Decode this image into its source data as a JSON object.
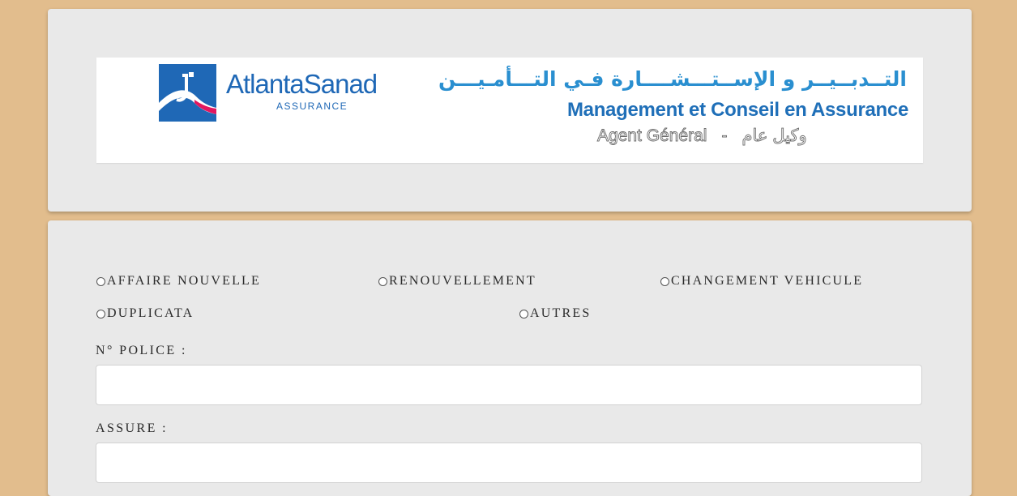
{
  "header": {
    "logo": {
      "name": "AtlantaSanad",
      "subtitle": "ASSURANCE",
      "icon": "atlantasanad-logo-icon"
    },
    "arabic_title": "التــدبــيــر و الإســتـــشــــارة فـي التـــأمـيـــن",
    "french_title": "Management et Conseil en Assurance",
    "agent_fr": "Agent Général",
    "separator": "-",
    "agent_ar": "وكيل عام"
  },
  "form": {
    "options": [
      {
        "label": "AFFAIRE NOUVELLE",
        "selected": false
      },
      {
        "label": "RENOUVELLEMENT",
        "selected": false
      },
      {
        "label": "CHANGEMENT VEHICULE",
        "selected": false
      },
      {
        "label": "DUPLICATA",
        "selected": false
      },
      {
        "label": "AUTRES",
        "selected": false
      }
    ],
    "police_label": "N° POLICE :",
    "police_value": "",
    "assure_label": "ASSURE :",
    "assure_value": ""
  },
  "colors": {
    "page_background": "#e2bd8d",
    "card_background": "#e9e9e9",
    "brand_blue": "#1f68b6",
    "brand_accent": "#e2175f"
  }
}
